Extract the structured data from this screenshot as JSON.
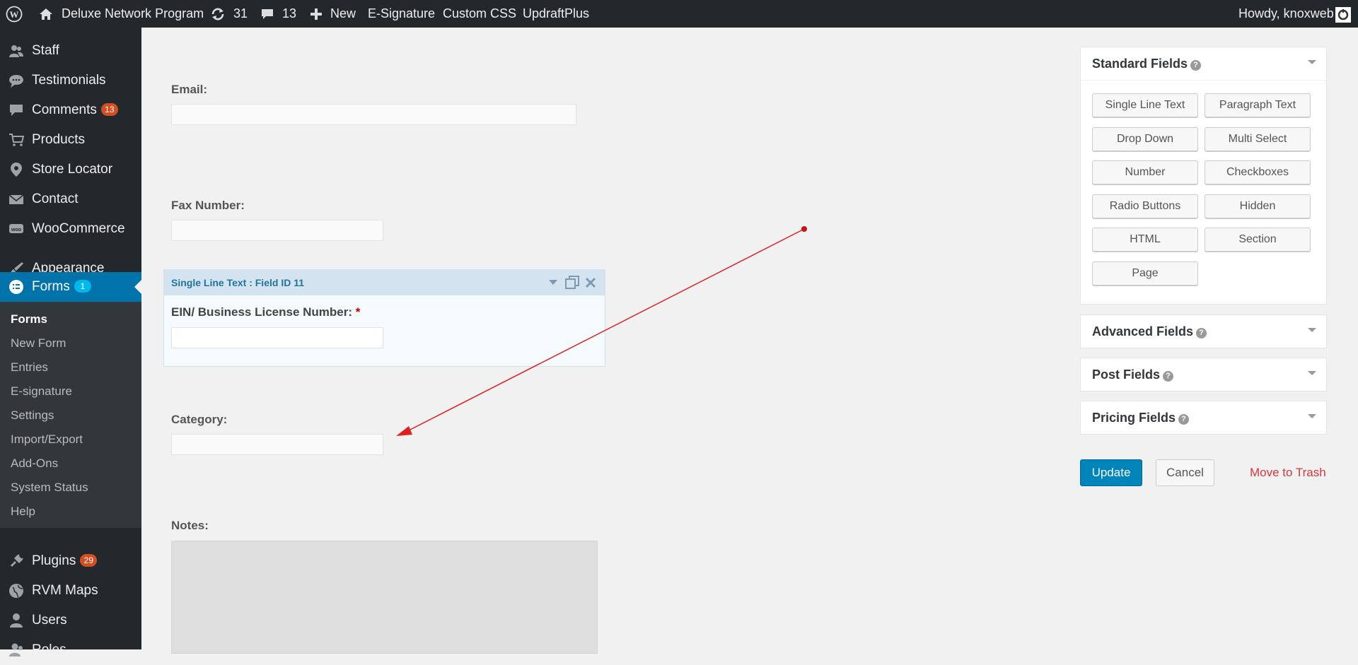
{
  "adminbar": {
    "site_name": "Deluxe Network Program",
    "updates_count": "31",
    "comments_count": "13",
    "new_label": "New",
    "links": [
      "E-Signature",
      "Custom CSS",
      "UpdraftPlus"
    ],
    "greeting": "Howdy, knoxweb"
  },
  "sidebar": {
    "items": [
      {
        "label": "Staff",
        "icon": "staff-icon"
      },
      {
        "label": "Testimonials",
        "icon": "speech-bubble-icon"
      },
      {
        "label": "Comments",
        "icon": "comment-icon",
        "badge": "13"
      },
      {
        "label": "Products",
        "icon": "cart-icon"
      },
      {
        "label": "Store Locator",
        "icon": "location-pin-icon"
      },
      {
        "label": "Contact",
        "icon": "envelope-icon"
      },
      {
        "label": "WooCommerce",
        "icon": "woo-icon"
      },
      {
        "label": "Appearance",
        "icon": "paintbrush-icon"
      },
      {
        "label": "Forms",
        "icon": "forms-icon",
        "badge": "1"
      },
      {
        "label": "Plugins",
        "icon": "plugin-icon",
        "badge": "29"
      },
      {
        "label": "RVM Maps",
        "icon": "map-icon"
      },
      {
        "label": "Users",
        "icon": "user-icon"
      },
      {
        "label": "Roles",
        "icon": "roles-icon"
      }
    ],
    "forms_submenu": [
      "Forms",
      "New Form",
      "Entries",
      "E-signature",
      "Settings",
      "Import/Export",
      "Add-Ons",
      "System Status",
      "Help"
    ]
  },
  "form": {
    "email_label": "Email:",
    "fax_label": "Fax Number:",
    "selected_field_title": "Single Line Text : Field ID 11",
    "selected_field_label": "EIN/ Business License Number:",
    "required_marker": "*",
    "category_label": "Category:",
    "notes_label": "Notes:"
  },
  "panels": {
    "standard": {
      "title": "Standard Fields",
      "buttons": [
        "Single Line Text",
        "Paragraph Text",
        "Drop Down",
        "Multi Select",
        "Number",
        "Checkboxes",
        "Radio Buttons",
        "Hidden",
        "HTML",
        "Section",
        "Page"
      ]
    },
    "advanced": {
      "title": "Advanced Fields"
    },
    "post": {
      "title": "Post Fields"
    },
    "pricing": {
      "title": "Pricing Fields"
    }
  },
  "actions": {
    "update": "Update",
    "cancel": "Cancel",
    "trash": "Move to Trash"
  },
  "colors": {
    "accent": "#0073aa",
    "trash_link": "#d63638",
    "annotation_arrow": "#e02020"
  }
}
